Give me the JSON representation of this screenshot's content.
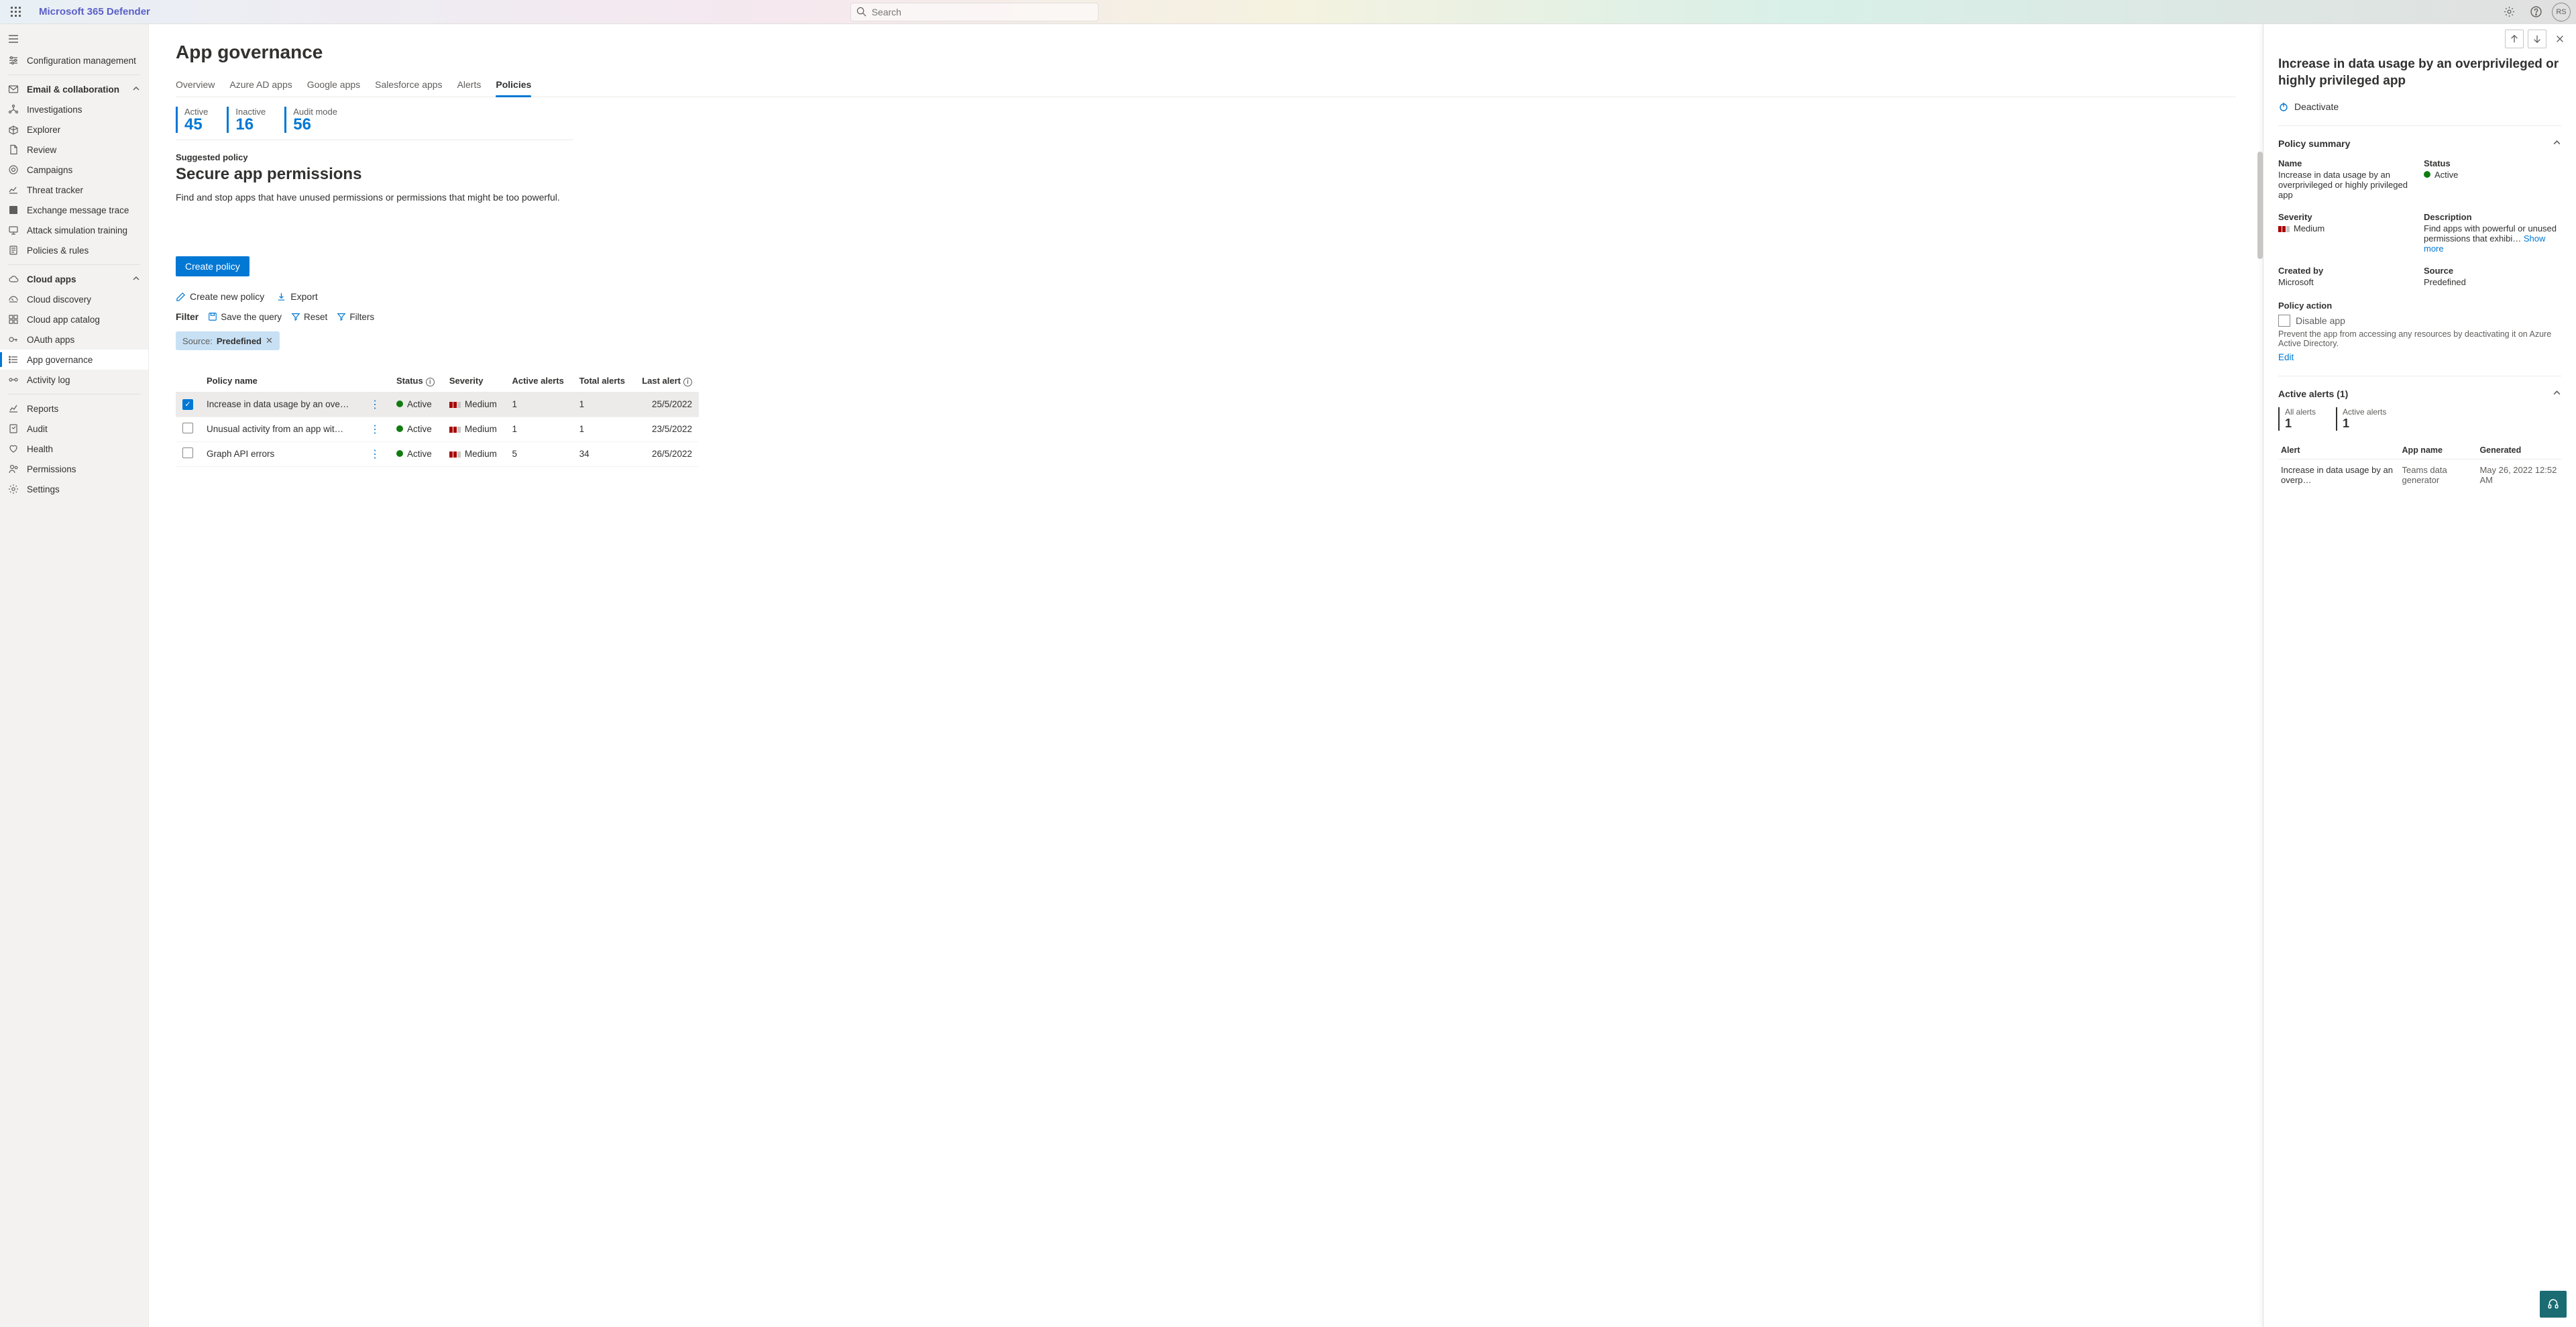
{
  "header": {
    "brand": "Microsoft 365 Defender",
    "search_placeholder": "Search",
    "avatar_initials": "RS"
  },
  "sidebar": {
    "item_config": "Configuration management",
    "group_email": "Email & collaboration",
    "item_investigations": "Investigations",
    "item_explorer": "Explorer",
    "item_review": "Review",
    "item_campaigns": "Campaigns",
    "item_threat_tracker": "Threat tracker",
    "item_exchange_trace": "Exchange message trace",
    "item_attack_sim": "Attack simulation training",
    "item_policies_rules": "Policies & rules",
    "group_cloud": "Cloud apps",
    "item_cloud_discovery": "Cloud discovery",
    "item_cloud_catalog": "Cloud app catalog",
    "item_oauth": "OAuth apps",
    "item_app_gov": "App governance",
    "item_activity_log": "Activity log",
    "item_reports": "Reports",
    "item_audit": "Audit",
    "item_health": "Health",
    "item_permissions": "Permissions",
    "item_settings": "Settings"
  },
  "main": {
    "title": "App governance",
    "tabs": {
      "overview": "Overview",
      "azure": "Azure AD apps",
      "google": "Google apps",
      "salesforce": "Salesforce apps",
      "alerts": "Alerts",
      "policies": "Policies"
    },
    "kpis": {
      "active_label": "Active",
      "active_value": "45",
      "inactive_label": "Inactive",
      "inactive_value": "16",
      "audit_label": "Audit mode",
      "audit_value": "56"
    },
    "suggested_label": "Suggested policy",
    "suggested_title": "Secure app permissions",
    "suggested_desc": "Find and stop apps that have unused permissions or permissions that might be too powerful.",
    "create_policy": "Create policy",
    "toolbar": {
      "create_new": "Create new policy",
      "export": "Export"
    },
    "filters": {
      "label": "Filter",
      "save_query": "Save the query",
      "reset": "Reset",
      "filters": "Filters",
      "chip_key": "Source:",
      "chip_value": "Predefined"
    },
    "table": {
      "col_name": "Policy name",
      "col_status": "Status",
      "col_severity": "Severity",
      "col_active": "Active alerts",
      "col_total": "Total alerts",
      "col_last": "Last alert",
      "rows": [
        {
          "name": "Increase in data usage by an ove…",
          "status": "Active",
          "severity": "Medium",
          "active": "1",
          "total": "1",
          "last": "25/5/2022",
          "selected": true
        },
        {
          "name": "Unusual activity from an app wit…",
          "status": "Active",
          "severity": "Medium",
          "active": "1",
          "total": "1",
          "last": "23/5/2022",
          "selected": false
        },
        {
          "name": "Graph API errors",
          "status": "Active",
          "severity": "Medium",
          "active": "5",
          "total": "34",
          "last": "26/5/2022",
          "selected": false
        }
      ]
    }
  },
  "panel": {
    "title": "Increase in data usage by an overprivileged or highly privileged app",
    "deactivate": "Deactivate",
    "summary_head": "Policy summary",
    "name_label": "Name",
    "name_value": "Increase in data usage by an overprivileged or highly privileged app",
    "status_label": "Status",
    "status_value": "Active",
    "severity_label": "Severity",
    "severity_value": "Medium",
    "description_label": "Description",
    "description_value": "Find apps with powerful or unused permissions that exhibi…",
    "show_more": "Show more",
    "created_label": "Created by",
    "created_value": "Microsoft",
    "source_label": "Source",
    "source_value": "Predefined",
    "policy_action_label": "Policy action",
    "disable_app": "Disable app",
    "disable_caption": "Prevent the app from accessing any resources by deactivating it on Azure Active Directory.",
    "edit": "Edit",
    "active_alerts_head": "Active alerts (1)",
    "kpi_all_label": "All alerts",
    "kpi_all_value": "1",
    "kpi_active_label": "Active alerts",
    "kpi_active_value": "1",
    "alert_table": {
      "col_alert": "Alert",
      "col_app": "App name",
      "col_gen": "Generated",
      "row_alert": "Increase in data usage by an overp…",
      "row_app": "Teams data generator",
      "row_gen": "May 26, 2022 12:52 AM"
    }
  }
}
